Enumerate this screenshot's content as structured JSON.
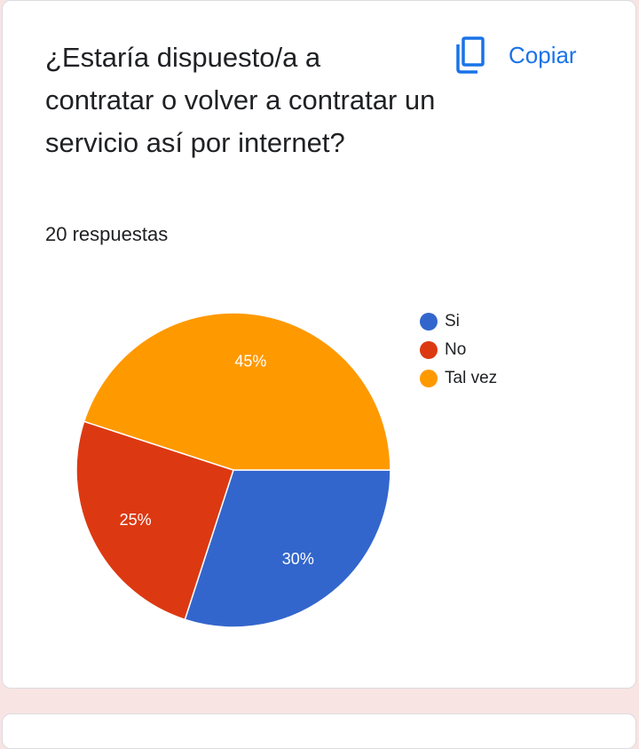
{
  "question": "¿Estaría dispuesto/a a contratar o volver a contratar un servicio así por internet?",
  "responses_count": "20 respuestas",
  "copy_label": "Copiar",
  "chart_data": {
    "type": "pie",
    "categories": [
      "Si",
      "No",
      "Tal vez"
    ],
    "values": [
      30,
      25,
      45
    ],
    "labels": [
      "30%",
      "25%",
      "45%"
    ],
    "colors": [
      "#3366cc",
      "#dc3912",
      "#ff9900"
    ],
    "legend_position": "top-right"
  }
}
